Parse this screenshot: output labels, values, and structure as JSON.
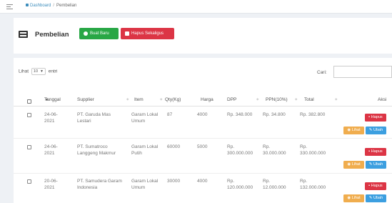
{
  "breadcrumb": {
    "home": "Dashboard",
    "separator": "/",
    "current": "Pembelian"
  },
  "header": {
    "title": "Pembelian",
    "new_button": "Buat Baru",
    "delete_all_button": "Hapus Sekaligus"
  },
  "table_controls": {
    "show_label": "Lihat",
    "show_value": "10",
    "entries_label": "entri",
    "search_label": "Cari:"
  },
  "columns": [
    "Tanggal",
    "Supplier",
    "Item",
    "Qty(Kg)",
    "Harga",
    "DPP",
    "PPN(10%)",
    "Total",
    "Aksi"
  ],
  "sorted_indicator": "▼",
  "rows": [
    {
      "tanggal": "24-06-\n2021",
      "supplier": "PT. Garuda Mas\nLestari",
      "item": "Garam Lokal\nUmum",
      "qty": "87",
      "harga": "4000",
      "dpp": "Rp. 348.000",
      "ppn": "Rp. 34.800",
      "total": "Rp. 382.800"
    },
    {
      "tanggal": "24-06-\n2021",
      "supplier": "PT. Sumatroco\nLanggeng Makmur",
      "item": "Garam Lokal\nPutih",
      "qty": "60000",
      "harga": "5000",
      "dpp": "Rp.\n300.000.000",
      "ppn": "Rp.\n30.000.000",
      "total": "Rp.\n330.000.000"
    },
    {
      "tanggal": "20-06-\n2021",
      "supplier": "PT. Samudera Garam\nIndonesia",
      "item": "Garam Lokal\nUmum",
      "qty": "30000",
      "harga": "4000",
      "dpp": "Rp.\n120.000.000",
      "ppn": "Rp.\n12.000.000",
      "total": "Rp.\n132.000.000"
    }
  ],
  "actions": {
    "delete": "Hapus",
    "view": "Lihat",
    "edit": "Ubah"
  },
  "colors": {
    "primary": "#3c8dbc",
    "success": "#28a745",
    "danger": "#dc3545",
    "warning": "#f0ad4e",
    "info": "#3c9fe0"
  }
}
